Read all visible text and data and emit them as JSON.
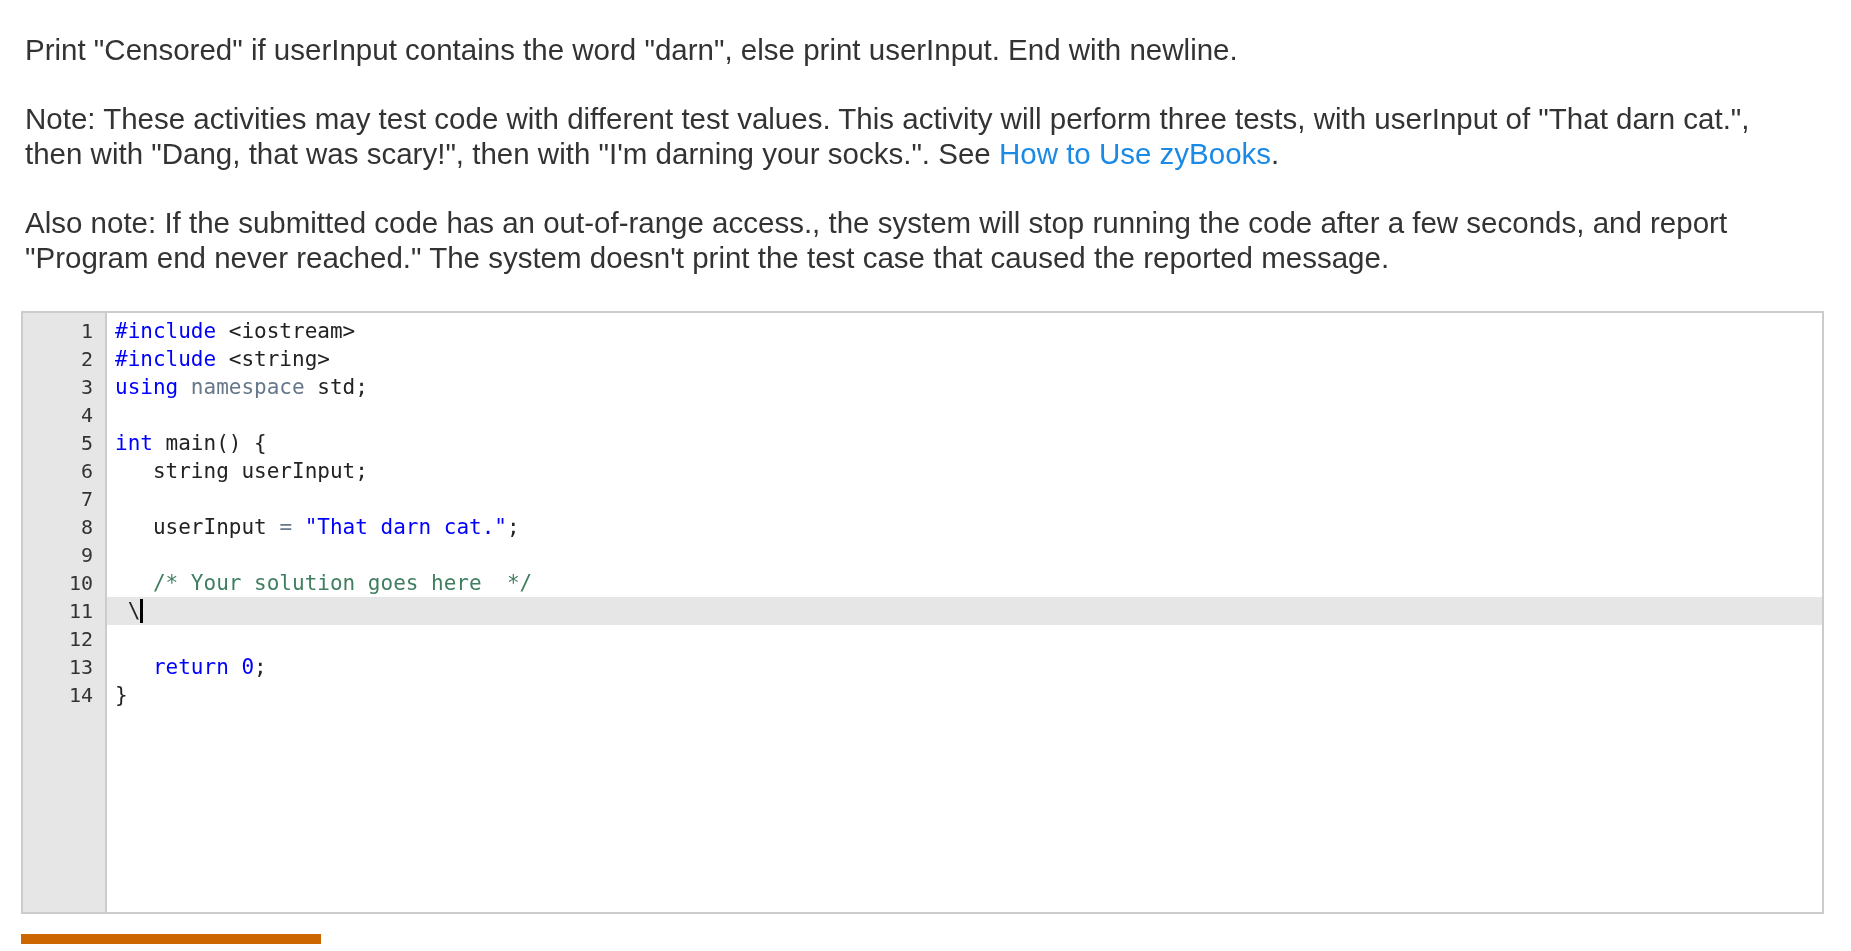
{
  "instructions": [
    {
      "text": "Print \"Censored\" if userInput contains the word \"darn\", else print userInput. End with newline."
    },
    {
      "text": "Note: These activities may test code with different test values. This activity will perform three tests, with userInput of \"That darn cat.\", then with \"Dang, that was scary!\", then with \"I'm darning your socks.\". See ",
      "link": "How to Use zyBooks",
      "after": "."
    },
    {
      "text": "Also note: If the submitted code has an out-of-range access., the system will stop running the code after a few seconds, and report \"Program end never reached.\" The system doesn't print the test case that caused the reported message."
    }
  ],
  "editor": {
    "lines": [
      {
        "number": "1",
        "active": false,
        "tokens": [
          {
            "kind": "keyword",
            "text": "#include"
          },
          {
            "kind": "plain",
            "text": " <iostream>"
          }
        ]
      },
      {
        "number": "2",
        "active": false,
        "tokens": [
          {
            "kind": "keyword",
            "text": "#include"
          },
          {
            "kind": "plain",
            "text": " <string>"
          }
        ]
      },
      {
        "number": "3",
        "active": false,
        "tokens": [
          {
            "kind": "keyword",
            "text": "using"
          },
          {
            "kind": "muted",
            "text": " namespace"
          },
          {
            "kind": "plain",
            "text": " std;"
          }
        ]
      },
      {
        "number": "4",
        "active": false
      },
      {
        "number": "5",
        "active": false,
        "tokens": [
          {
            "kind": "keyword",
            "text": "int"
          },
          {
            "kind": "plain",
            "text": " main() {"
          }
        ]
      },
      {
        "number": "6",
        "active": false,
        "tokens": [
          {
            "kind": "plain",
            "text": "   string userInput;"
          }
        ]
      },
      {
        "number": "7",
        "active": false
      },
      {
        "number": "8",
        "active": false,
        "tokens": [
          {
            "kind": "plain",
            "text": "   userInput "
          },
          {
            "kind": "muted",
            "text": "="
          },
          {
            "kind": "string",
            "text": " \"That darn cat.\""
          },
          {
            "kind": "plain",
            "text": ";"
          }
        ]
      },
      {
        "number": "9",
        "active": false
      },
      {
        "number": "10",
        "active": false,
        "tokens": [
          {
            "kind": "comment",
            "text": "   /* Your solution goes here  */"
          }
        ]
      },
      {
        "number": "11",
        "active": true,
        "tokens": [
          {
            "kind": "plain",
            "text": " \\"
          }
        ]
      },
      {
        "number": "12",
        "active": false
      },
      {
        "number": "13",
        "active": false,
        "tokens": [
          {
            "kind": "keyword",
            "text": "   return"
          },
          {
            "kind": "keyword",
            "text": " 0"
          },
          {
            "kind": "plain",
            "text": ";"
          }
        ]
      },
      {
        "number": "14",
        "active": false,
        "tokens": [
          {
            "kind": "plain",
            "text": "}"
          }
        ]
      }
    ]
  }
}
